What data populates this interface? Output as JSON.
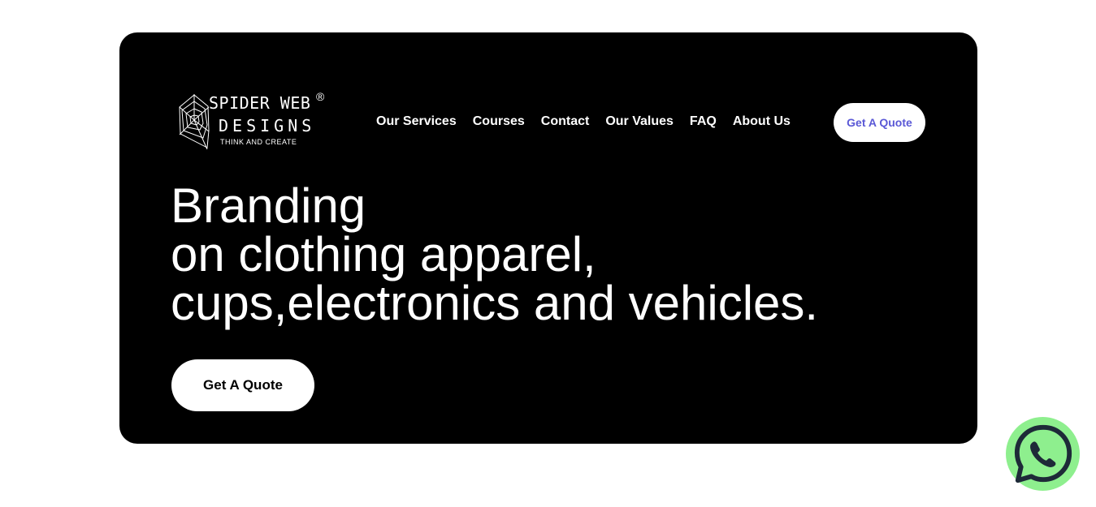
{
  "logo": {
    "line1": "SPIDER WEB",
    "line2": "DESIGNS",
    "registered": "®",
    "tagline": "THINK AND CREATE"
  },
  "nav": {
    "items": [
      {
        "label": "Our Services"
      },
      {
        "label": "Courses"
      },
      {
        "label": "Contact"
      },
      {
        "label": "Our Values"
      },
      {
        "label": "FAQ"
      },
      {
        "label": "About Us"
      }
    ],
    "cta_label": "Get A Quote"
  },
  "hero": {
    "headline_lines": [
      "Branding",
      "on clothing apparel,",
      "cups,electronics and vehicles."
    ],
    "cta_label": "Get A Quote"
  },
  "whatsapp": {
    "icon": "whatsapp-icon"
  },
  "colors": {
    "hero_background": "#000000",
    "nav_cta_text": "#5a58d6",
    "whatsapp_green": "#8eef8e",
    "whatsapp_stroke": "#1e2a38"
  }
}
